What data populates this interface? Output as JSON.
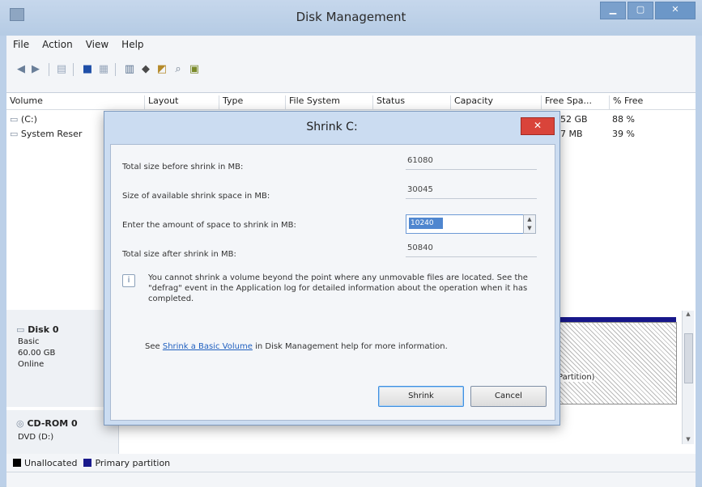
{
  "window": {
    "title": "Disk Management"
  },
  "menu": [
    "File",
    "Action",
    "View",
    "Help"
  ],
  "volumes": {
    "columns": [
      "Volume",
      "Layout",
      "Type",
      "File System",
      "Status",
      "Capacity",
      "Free Spa...",
      "% Free"
    ],
    "rows": [
      {
        "volume": "(C:)",
        "free": "52 GB",
        "pct": "88 %"
      },
      {
        "volume": "System Reser",
        "free": "7 MB",
        "pct": "39 %"
      }
    ]
  },
  "disks": {
    "disk0": {
      "name": "Disk 0",
      "kind": "Basic",
      "size": "60.00 GB",
      "state": "Online",
      "partition_text": "Partition)"
    },
    "cdrom": {
      "name": "CD-ROM 0",
      "kind": "DVD (D:)"
    }
  },
  "legend": [
    {
      "label": "Unallocated",
      "color": "#000000"
    },
    {
      "label": "Primary partition",
      "color": "#1a1a8c"
    }
  ],
  "dialog": {
    "title": "Shrink C:",
    "close_label": "✕",
    "fields": [
      {
        "label": "Total size before shrink in MB:",
        "value": "61080"
      },
      {
        "label": "Size of available shrink space in MB:",
        "value": "30045"
      },
      {
        "label": "Enter the amount of space to shrink in MB:",
        "value": "10240"
      },
      {
        "label": "Total size after shrink in MB:",
        "value": "50840"
      }
    ],
    "info_text": "You cannot shrink a volume beyond the point where any unmovable files are located. See the \"defrag\" event in the Application log for detailed information about the operation when it has completed.",
    "see_prefix": "See",
    "see_link": "Shrink a Basic Volume",
    "see_suffix": "in Disk Management help for more information.",
    "shrink_label": "Shrink",
    "cancel_label": "Cancel"
  }
}
